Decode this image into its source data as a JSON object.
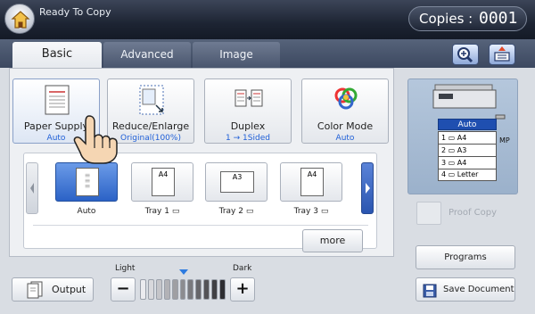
{
  "header": {
    "status": "Ready To Copy",
    "copies_label": "Copies :",
    "copies_count": "0001"
  },
  "tabs": [
    {
      "label": "Basic",
      "active": true
    },
    {
      "label": "Advanced",
      "active": false
    },
    {
      "label": "Image",
      "active": false
    }
  ],
  "functions": {
    "paper_supply": {
      "label": "Paper Supply",
      "value": "Auto"
    },
    "reduce_enlarge": {
      "label": "Reduce/Enlarge",
      "value": "Original(100%)"
    },
    "duplex": {
      "label": "Duplex",
      "value": "1 → 1Sided"
    },
    "color_mode": {
      "label": "Color Mode",
      "value": "Auto"
    }
  },
  "trays": [
    {
      "label": "Auto",
      "paper": "",
      "selected": true
    },
    {
      "label": "Tray 1",
      "paper": "A4",
      "selected": false
    },
    {
      "label": "Tray 2",
      "paper": "A3",
      "selected": false
    },
    {
      "label": "Tray 3",
      "paper": "A4",
      "selected": false
    }
  ],
  "more_label": "more",
  "machine": {
    "auto_label": "Auto",
    "trays": [
      {
        "num": "1",
        "paper": "A4"
      },
      {
        "num": "2",
        "paper": "A3"
      },
      {
        "num": "3",
        "paper": "A4"
      },
      {
        "num": "4",
        "paper": "Letter"
      }
    ],
    "mp_label": "MP"
  },
  "proof_copy_label": "Proof Copy",
  "programs_label": "Programs",
  "save_document_label": "Save Document",
  "output_label": "Output",
  "density": {
    "light_label": "Light",
    "dark_label": "Dark",
    "minus": "−",
    "plus": "+",
    "level": 5,
    "steps": 11
  },
  "colors": {
    "accent_blue": "#2b62c6",
    "value_text": "#2060d8",
    "header_bg": "#1d2433"
  }
}
